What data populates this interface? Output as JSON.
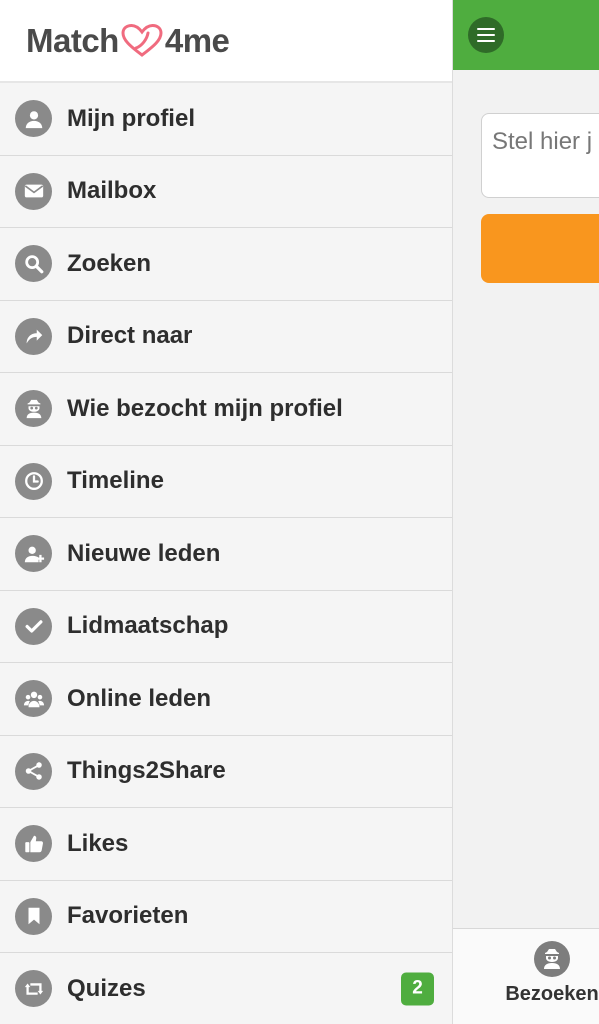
{
  "logo": {
    "left": "Match",
    "right": "4me",
    "heart_color": "#f06b7f"
  },
  "header": {
    "bg_color": "#4fad3f",
    "menu_icon": "hamburger-icon"
  },
  "main": {
    "question_placeholder": "Stel hier j",
    "button_color": "#f9961e"
  },
  "bottom_bar": {
    "tab_label": "Bezoeken",
    "tab_icon": "spy-icon"
  },
  "menu": {
    "items": [
      {
        "label": "Mijn profiel",
        "icon": "user-icon"
      },
      {
        "label": "Mailbox",
        "icon": "envelope-icon"
      },
      {
        "label": "Zoeken",
        "icon": "search-icon"
      },
      {
        "label": "Direct naar",
        "icon": "share-arrow-icon"
      },
      {
        "label": "Wie bezocht mijn profiel",
        "icon": "spy-icon"
      },
      {
        "label": "Timeline",
        "icon": "clock-icon"
      },
      {
        "label": "Nieuwe leden",
        "icon": "user-plus-icon"
      },
      {
        "label": "Lidmaatschap",
        "icon": "check-icon"
      },
      {
        "label": "Online leden",
        "icon": "users-icon"
      },
      {
        "label": "Things2Share",
        "icon": "share-icon"
      },
      {
        "label": "Likes",
        "icon": "thumbs-up-icon"
      },
      {
        "label": "Favorieten",
        "icon": "bookmark-icon"
      },
      {
        "label": "Quizes",
        "icon": "retweet-icon",
        "badge": "2"
      }
    ]
  }
}
